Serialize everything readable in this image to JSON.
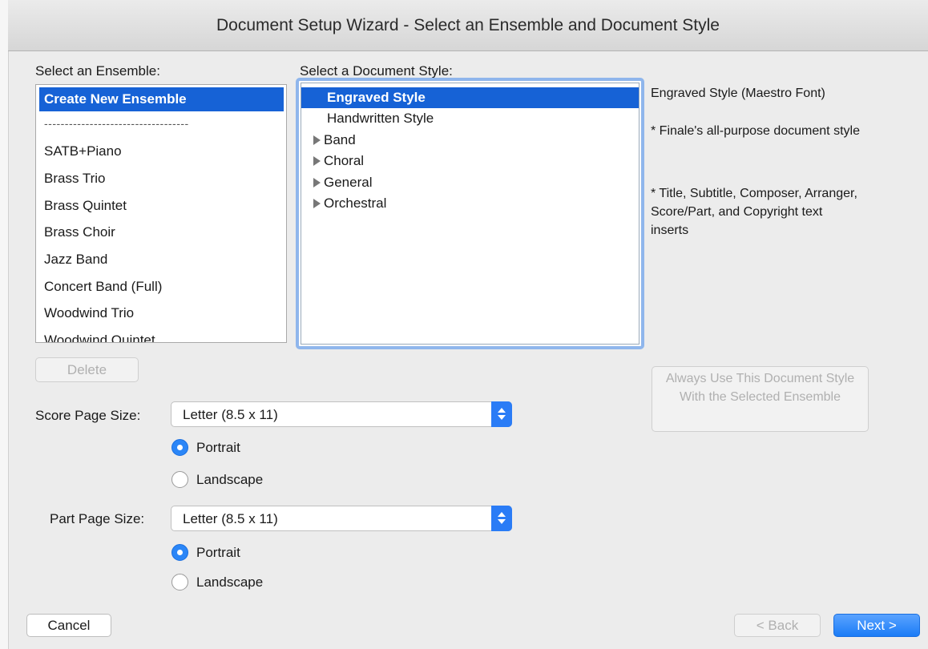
{
  "window": {
    "title": "Document Setup Wizard - Select an Ensemble and Document Style"
  },
  "ensemble": {
    "label": "Select an Ensemble:",
    "items": [
      {
        "label": "Create New Ensemble",
        "selected": true
      },
      {
        "label": "SATB+Piano"
      },
      {
        "label": "Brass Trio"
      },
      {
        "label": "Brass Quintet"
      },
      {
        "label": "Brass Choir"
      },
      {
        "label": "Jazz Band"
      },
      {
        "label": "Concert Band (Full)"
      },
      {
        "label": "Woodwind Trio"
      },
      {
        "label": "Woodwind Quintet"
      }
    ],
    "separator": "-----------------------------------",
    "delete_label": "Delete"
  },
  "style": {
    "label": "Select a Document Style:",
    "items": [
      {
        "label": "Engraved Style",
        "selected": true
      },
      {
        "label": "Handwritten Style"
      },
      {
        "label": "Band",
        "folder": true
      },
      {
        "label": "Choral",
        "folder": true
      },
      {
        "label": "General",
        "folder": true
      },
      {
        "label": "Orchestral",
        "folder": true
      }
    ]
  },
  "description": {
    "title": "Engraved Style (Maestro Font)",
    "line1": "* Finale's all-purpose document style",
    "line2": "* Title, Subtitle, Composer, Arranger, Score/Part, and Copyright text inserts"
  },
  "always_use_label": "Always Use This Document Style With the Selected Ensemble",
  "score": {
    "label": "Score Page Size:",
    "value": "Letter (8.5 x 11)",
    "portrait": "Portrait",
    "landscape": "Landscape",
    "orientation": "Portrait"
  },
  "part": {
    "label": "Part Page Size:",
    "value": "Letter (8.5 x 11)",
    "portrait": "Portrait",
    "landscape": "Landscape",
    "orientation": "Portrait"
  },
  "buttons": {
    "cancel": "Cancel",
    "back": "< Back",
    "next": "Next >"
  },
  "colors": {
    "selection": "#1662d6",
    "accent": "#2b86f7"
  }
}
